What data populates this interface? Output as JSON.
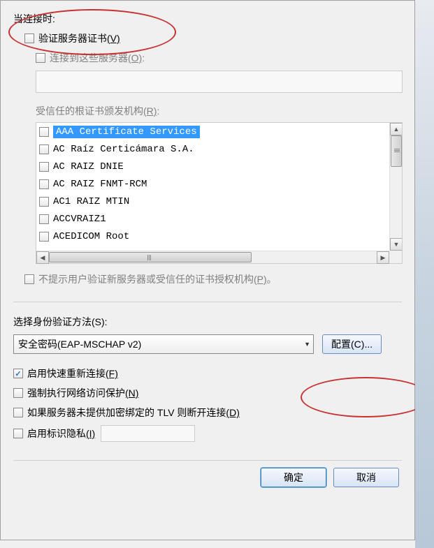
{
  "header": {
    "whenConnecting": "当连接时:"
  },
  "validateCert": {
    "label": "验证服务器证书",
    "shortcut": "(V)"
  },
  "connectServers": {
    "label": "连接到这些服务器",
    "shortcut": "(O)",
    "value": ""
  },
  "trustedRoot": {
    "label": "受信任的根证书颁发机构",
    "shortcut": "(R)"
  },
  "certificates": [
    "AAA Certificate Services",
    "AC Raíz Certicámara S.A.",
    "AC RAIZ DNIE",
    "AC RAIZ FNMT-RCM",
    "AC1 RAIZ MTIN",
    "ACCVRAIZ1",
    "ACEDICOM Root"
  ],
  "noPrompt": {
    "label": "不提示用户验证新服务器或受信任的证书授权机构",
    "shortcut": "(P)",
    "suffix": "。"
  },
  "authMethod": {
    "label": "选择身份验证方法",
    "shortcut": "(S)",
    "selected": "安全密码(EAP-MSCHAP v2)"
  },
  "configureBtn": {
    "label": "配置",
    "shortcut": "(C)",
    "ellipsis": "..."
  },
  "opts": {
    "fastReconnect": {
      "label": "启用快速重新连接",
      "shortcut": "(F)",
      "checked": true
    },
    "enforceNAP": {
      "label": "强制执行网络访问保护",
      "shortcut": "(N)",
      "checked": false
    },
    "disconnectTLV": {
      "label": "如果服务器未提供加密绑定的 TLV 则断开连接",
      "shortcut": "(D)",
      "checked": false
    },
    "identityPrivacy": {
      "label": "启用标识隐私",
      "shortcut": "(I)",
      "checked": false,
      "value": ""
    }
  },
  "buttons": {
    "ok": "确定",
    "cancel": "取消"
  }
}
